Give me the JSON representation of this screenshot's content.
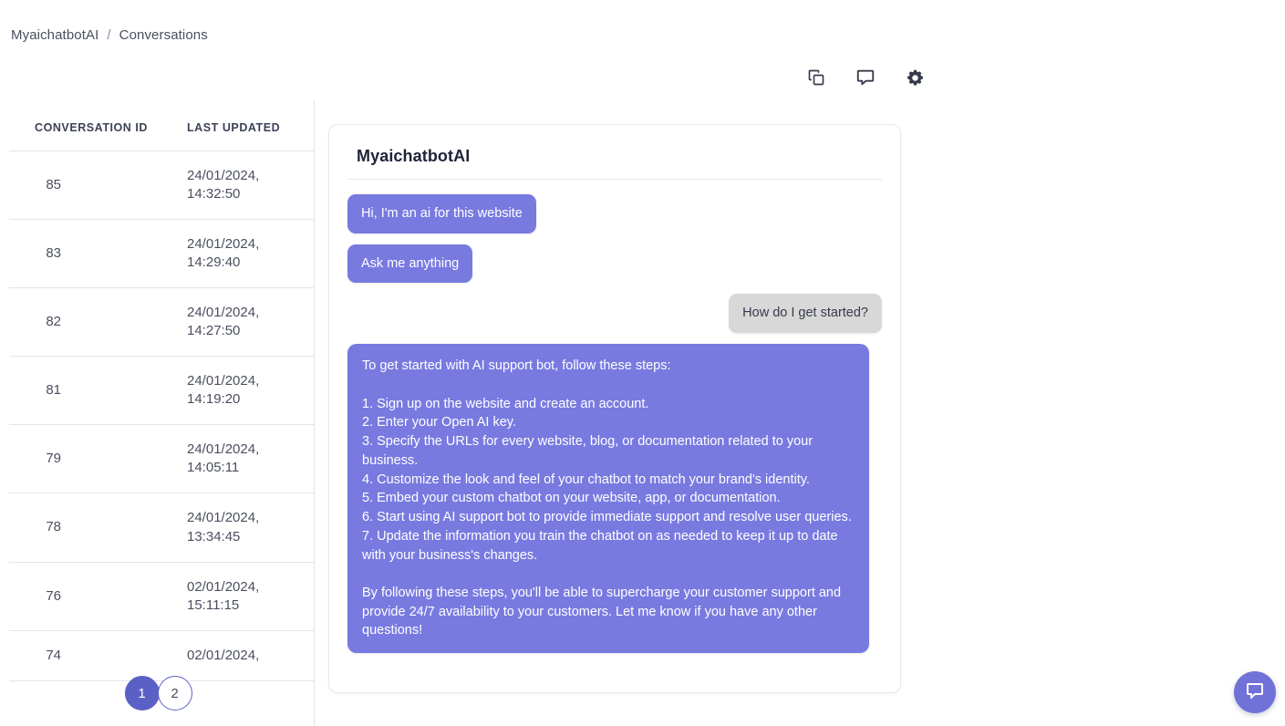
{
  "breadcrumb": {
    "root": "MyaichatbotAI",
    "separator": "/",
    "current": "Conversations"
  },
  "toolbar": {
    "copy_label": "copy-icon",
    "chat_label": "chat-icon",
    "settings_label": "gear-icon"
  },
  "table": {
    "headers": {
      "id": "CONVERSATION ID",
      "updated": "LAST UPDATED"
    },
    "rows": [
      {
        "id": "85",
        "updated": "24/01/2024, 14:32:50"
      },
      {
        "id": "83",
        "updated": "24/01/2024, 14:29:40"
      },
      {
        "id": "82",
        "updated": "24/01/2024, 14:27:50"
      },
      {
        "id": "81",
        "updated": "24/01/2024, 14:19:20"
      },
      {
        "id": "79",
        "updated": "24/01/2024, 14:05:11"
      },
      {
        "id": "78",
        "updated": "24/01/2024, 13:34:45"
      },
      {
        "id": "76",
        "updated": "02/01/2024, 15:11:15"
      },
      {
        "id": "74",
        "updated": "02/01/2024,"
      }
    ]
  },
  "pagination": {
    "pages": [
      "1",
      "2"
    ],
    "active": "1"
  },
  "chat": {
    "title": "MyaichatbotAI",
    "messages": [
      {
        "from": "bot",
        "text": "Hi, I'm an ai for this website"
      },
      {
        "from": "bot",
        "text": "Ask me anything"
      },
      {
        "from": "user",
        "text": "How do I get started?"
      },
      {
        "from": "bot",
        "long": true,
        "text": "To get started with AI support bot, follow these steps:\n\n1. Sign up on the website and create an account.\n2. Enter your Open AI key.\n3. Specify the URLs for every website, blog, or documentation related to your business.\n4. Customize the look and feel of your chatbot to match your brand's identity.\n5. Embed your custom chatbot on your website, app, or documentation.\n6. Start using AI support bot to provide immediate support and resolve user queries.\n7. Update the information you train the chatbot on as needed to keep it up to date with your business's changes.\n\nBy following these steps, you'll be able to supercharge your customer support and provide 24/7 availability to your customers. Let me know if you have any other questions!"
      }
    ]
  },
  "widget": {
    "label": "chat-widget-icon"
  },
  "colors": {
    "bot_bubble": "#787ae0",
    "user_bubble": "#d8d8d8",
    "pagination_active": "#5b61c4",
    "widget": "#7072d8",
    "text": "#4a4f5e",
    "border": "#e3e5ea"
  }
}
